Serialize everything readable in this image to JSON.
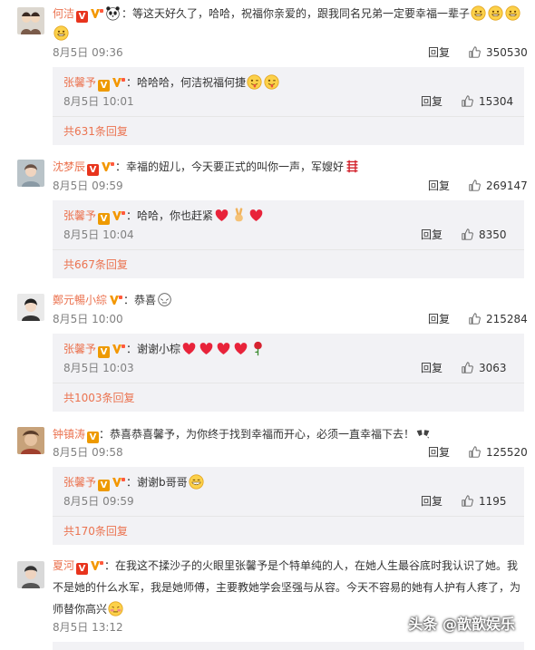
{
  "reply_label": "回复",
  "comments": [
    {
      "user": "何洁",
      "text": "：等这天好久了，哈哈，祝福你亲爱的，跟我同名兄弟一定要幸福一辈子",
      "time": "8月5日 09:36",
      "likes": "350530",
      "reply": {
        "user": "张馨予",
        "text": "：哈哈哈，何洁祝福何捷",
        "time": "8月5日 10:01",
        "likes": "15304"
      },
      "more": "共631条回复"
    },
    {
      "user": "沈梦辰",
      "text": "：幸福的妞儿，今天要正式的叫你一声，军嫂好",
      "time": "8月5日 09:59",
      "likes": "269147",
      "reply": {
        "user": "张馨予",
        "text": "：哈哈，你也赶紧",
        "time": "8月5日 10:04",
        "likes": "8350"
      },
      "more": "共667条回复"
    },
    {
      "user": "鄭元暢小綜",
      "text": "：恭喜",
      "time": "8月5日 10:00",
      "likes": "215284",
      "reply": {
        "user": "张馨予",
        "text": "：谢谢小棕",
        "time": "8月5日 10:03",
        "likes": "3063"
      },
      "more": "共1003条回复"
    },
    {
      "user": "钟镇涛",
      "text": "：恭喜恭喜馨予，为你终于找到幸福而开心，必须一直幸福下去！",
      "time": "8月5日 09:58",
      "likes": "125520",
      "reply": {
        "user": "张馨予",
        "text": "：谢谢b哥哥",
        "time": "8月5日 09:59",
        "likes": "1195"
      },
      "more": "共170条回复"
    },
    {
      "user": "夏河",
      "text_lines": [
        "：在我这不揉沙子的火眼里张馨予是个特单纯的人，在她人生最谷底时我认识了她。我",
        "不是她的什么水军，我是她师傅，主要教她学会坚强与从容。今天不容易的她有人护有人疼了，为",
        "师替你高兴"
      ],
      "time": "8月5日 13:12"
    }
  ],
  "watermark": "头条 @歆歆娱乐",
  "colors": {
    "username": "#eb7350",
    "reply_bg": "#f2f2f5",
    "text": "#333333",
    "meta": "#808080",
    "badge": "#ee9a00"
  }
}
